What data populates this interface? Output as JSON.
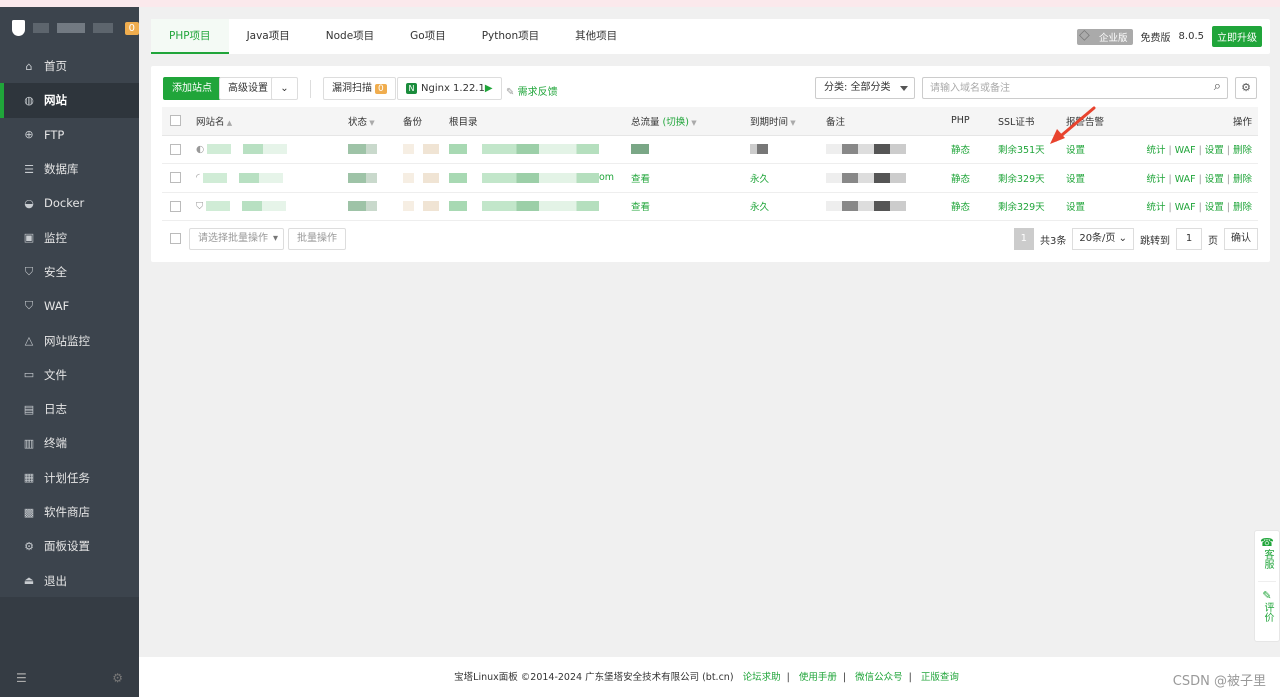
{
  "sidebar": {
    "badge": "0",
    "items": [
      {
        "label": "首页",
        "icon": "home-icon",
        "glyph": "⌂"
      },
      {
        "label": "网站",
        "icon": "globe-icon",
        "glyph": "◍"
      },
      {
        "label": "FTP",
        "icon": "ftp-icon",
        "glyph": "⊕"
      },
      {
        "label": "数据库",
        "icon": "database-icon",
        "glyph": "☰"
      },
      {
        "label": "Docker",
        "icon": "docker-icon",
        "glyph": "◒"
      },
      {
        "label": "监控",
        "icon": "monitor-icon",
        "glyph": "▣"
      },
      {
        "label": "安全",
        "icon": "shield-icon",
        "glyph": "⛉"
      },
      {
        "label": "WAF",
        "icon": "waf-shield-icon",
        "glyph": "⛉"
      },
      {
        "label": "网站监控",
        "icon": "site-monitor-icon",
        "glyph": "△"
      },
      {
        "label": "文件",
        "icon": "folder-icon",
        "glyph": "▭"
      },
      {
        "label": "日志",
        "icon": "log-icon",
        "glyph": "▤"
      },
      {
        "label": "终端",
        "icon": "terminal-icon",
        "glyph": "▥"
      },
      {
        "label": "计划任务",
        "icon": "schedule-icon",
        "glyph": "▦"
      },
      {
        "label": "软件商店",
        "icon": "store-icon",
        "glyph": "▩"
      },
      {
        "label": "面板设置",
        "icon": "settings-icon",
        "glyph": "⚙"
      },
      {
        "label": "退出",
        "icon": "logout-icon",
        "glyph": "⏏"
      }
    ],
    "active_index": 1
  },
  "tabs": [
    "PHP项目",
    "Java项目",
    "Node项目",
    "Go项目",
    "Python项目",
    "其他项目"
  ],
  "header_right": {
    "enterprise": "企业版",
    "free": "免费版",
    "version": "8.0.5",
    "upgrade": "立即升级"
  },
  "toolbar": {
    "add_site": "添加站点",
    "advanced": "高级设置",
    "vuln_scan": "漏洞扫描",
    "vuln_count": "0",
    "nginx": "Nginx 1.22.1",
    "feedback": "需求反馈",
    "category": "分类: 全部分类",
    "search_placeholder": "请输入域名或备注"
  },
  "table": {
    "headers": {
      "name": "网站名",
      "status": "状态",
      "backup": "备份",
      "root": "根目录",
      "traffic": "总流量",
      "traffic_switch": "(切换)",
      "expire": "到期时间",
      "note": "备注",
      "php": "PHP",
      "ssl": "SSL证书",
      "alert": "报警告警",
      "ops": "操作"
    },
    "rows": [
      {
        "root_suffix": "",
        "traffic": "",
        "expire": "",
        "php": "静态",
        "ssl": "剩余351天",
        "alert": "设置"
      },
      {
        "root_suffix": "om",
        "traffic": "查看",
        "expire": "永久",
        "php": "静态",
        "ssl": "剩余329天",
        "alert": "设置"
      },
      {
        "root_suffix": "",
        "traffic": "查看",
        "expire": "永久",
        "php": "静态",
        "ssl": "剩余329天",
        "alert": "设置"
      }
    ],
    "ops": [
      "统计",
      "WAF",
      "设置",
      "删除"
    ]
  },
  "footer_bar": {
    "batch_placeholder": "请选择批量操作",
    "batch_btn": "批量操作",
    "page": "1",
    "total": "共3条",
    "per_page": "20条/页",
    "jump_label": "跳转到",
    "jump_value": "1",
    "page_unit": "页",
    "confirm": "确认"
  },
  "float": {
    "service": "客服",
    "review": "评价"
  },
  "footer": {
    "copyright": "宝塔Linux面板 ©2014-2024 广东堡塔安全技术有限公司 (bt.cn)",
    "links": [
      "论坛求助",
      "使用手册",
      "微信公众号",
      "正版查询"
    ]
  },
  "watermark": "CSDN @被子里",
  "colors": {
    "accent": "#20a53a",
    "sidebar": "#3c444d",
    "badge": "#f0ad4e",
    "arrow": "#e8432e"
  }
}
